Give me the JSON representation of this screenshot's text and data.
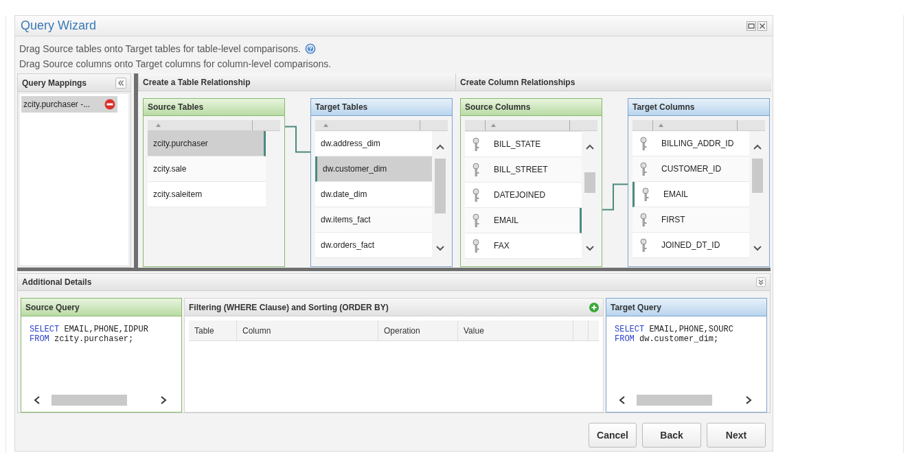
{
  "window": {
    "title": "Query Wizard"
  },
  "instructions": [
    "Drag Source tables onto Target tables for table-level comparisons.",
    "Drag Source columns onto Target columns for column-level comparisons."
  ],
  "query_mappings": {
    "title": "Query Mappings",
    "items": [
      {
        "label": "zcity.purchaser -...",
        "selected": true
      }
    ]
  },
  "table_relationship": {
    "title": "Create a Table Relationship",
    "source": {
      "title": "Source Tables",
      "items": [
        {
          "label": "zcity.purchaser",
          "selected": true,
          "linked": true
        },
        {
          "label": "zcity.sale",
          "selected": false,
          "linked": false
        },
        {
          "label": "zcity.saleitem",
          "selected": false,
          "linked": false
        }
      ]
    },
    "target": {
      "title": "Target Tables",
      "items": [
        {
          "label": "dw.address_dim",
          "selected": false,
          "linked": false
        },
        {
          "label": "dw.customer_dim",
          "selected": true,
          "linked": true
        },
        {
          "label": "dw.date_dim",
          "selected": false,
          "linked": false
        },
        {
          "label": "dw.items_fact",
          "selected": false,
          "linked": false
        },
        {
          "label": "dw.orders_fact",
          "selected": false,
          "linked": false
        }
      ]
    }
  },
  "column_relationship": {
    "title": "Create Column Relationships",
    "source": {
      "title": "Source Columns",
      "items": [
        {
          "label": "BILL_STATE",
          "linked": false
        },
        {
          "label": "BILL_STREET",
          "linked": false
        },
        {
          "label": "DATEJOINED",
          "linked": false
        },
        {
          "label": "EMAIL",
          "linked": true
        },
        {
          "label": "FAX",
          "linked": false
        }
      ]
    },
    "target": {
      "title": "Target Columns",
      "items": [
        {
          "label": "BILLING_ADDR_ID",
          "linked": false
        },
        {
          "label": "CUSTOMER_ID",
          "linked": false
        },
        {
          "label": "EMAIL",
          "linked": true
        },
        {
          "label": "FIRST",
          "linked": false
        },
        {
          "label": "JOINED_DT_ID",
          "linked": false
        }
      ]
    }
  },
  "additional_details": {
    "title": "Additional Details",
    "source_query": {
      "title": "Source Query",
      "lines": [
        {
          "keyword": "SELECT",
          "text": " EMAIL,PHONE,IDPUR"
        },
        {
          "keyword": "FROM",
          "text": " zcity.purchaser;"
        }
      ]
    },
    "filtering": {
      "title": "Filtering (WHERE Clause) and Sorting (ORDER BY)",
      "columns": [
        "Table",
        "Column",
        "Operation",
        "Value"
      ]
    },
    "target_query": {
      "title": "Target Query",
      "lines": [
        {
          "keyword": "SELECT",
          "text": " EMAIL,PHONE,SOURC"
        },
        {
          "keyword": "FROM",
          "text": " dw.customer_dim;"
        }
      ]
    }
  },
  "buttons": [
    "Cancel",
    "Back",
    "Next"
  ]
}
